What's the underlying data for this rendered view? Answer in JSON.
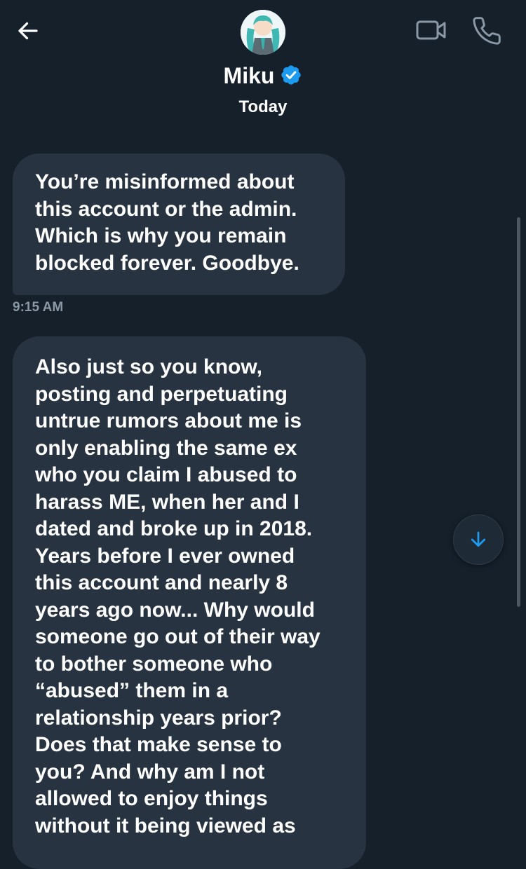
{
  "header": {
    "back_icon": "arrow-left-icon",
    "contact_name": "Miku",
    "verified_icon": "verified-badge-icon",
    "video_icon": "video-camera-icon",
    "call_icon": "phone-icon"
  },
  "date_separator": "Today",
  "messages": [
    {
      "text": "You’re misinformed about\nthis account or the admin.\nWhich is why you remain\nblocked forever. Goodbye.",
      "time": "9:15 AM"
    },
    {
      "text": "Also just so you know,\nposting and perpetuating\nuntrue rumors about me is\nonly enabling the same ex\nwho you claim I abused to\nharass ME, when her and I\ndated and broke up in 2018.\nYears before I ever owned\nthis account and nearly 8\nyears ago now... Why would\nsomeone go out of their way\nto bother someone who\n“abused” them in a\nrelationship years prior?\nDoes that make sense to\nyou? And why am I not\nallowed to enjoy things\nwithout it being viewed as"
    }
  ],
  "scroll_down_icon": "arrow-down-icon",
  "colors": {
    "background": "#15202b",
    "bubble": "#273340",
    "accent": "#1d9bf0",
    "timestamp": "#8b98a5"
  }
}
